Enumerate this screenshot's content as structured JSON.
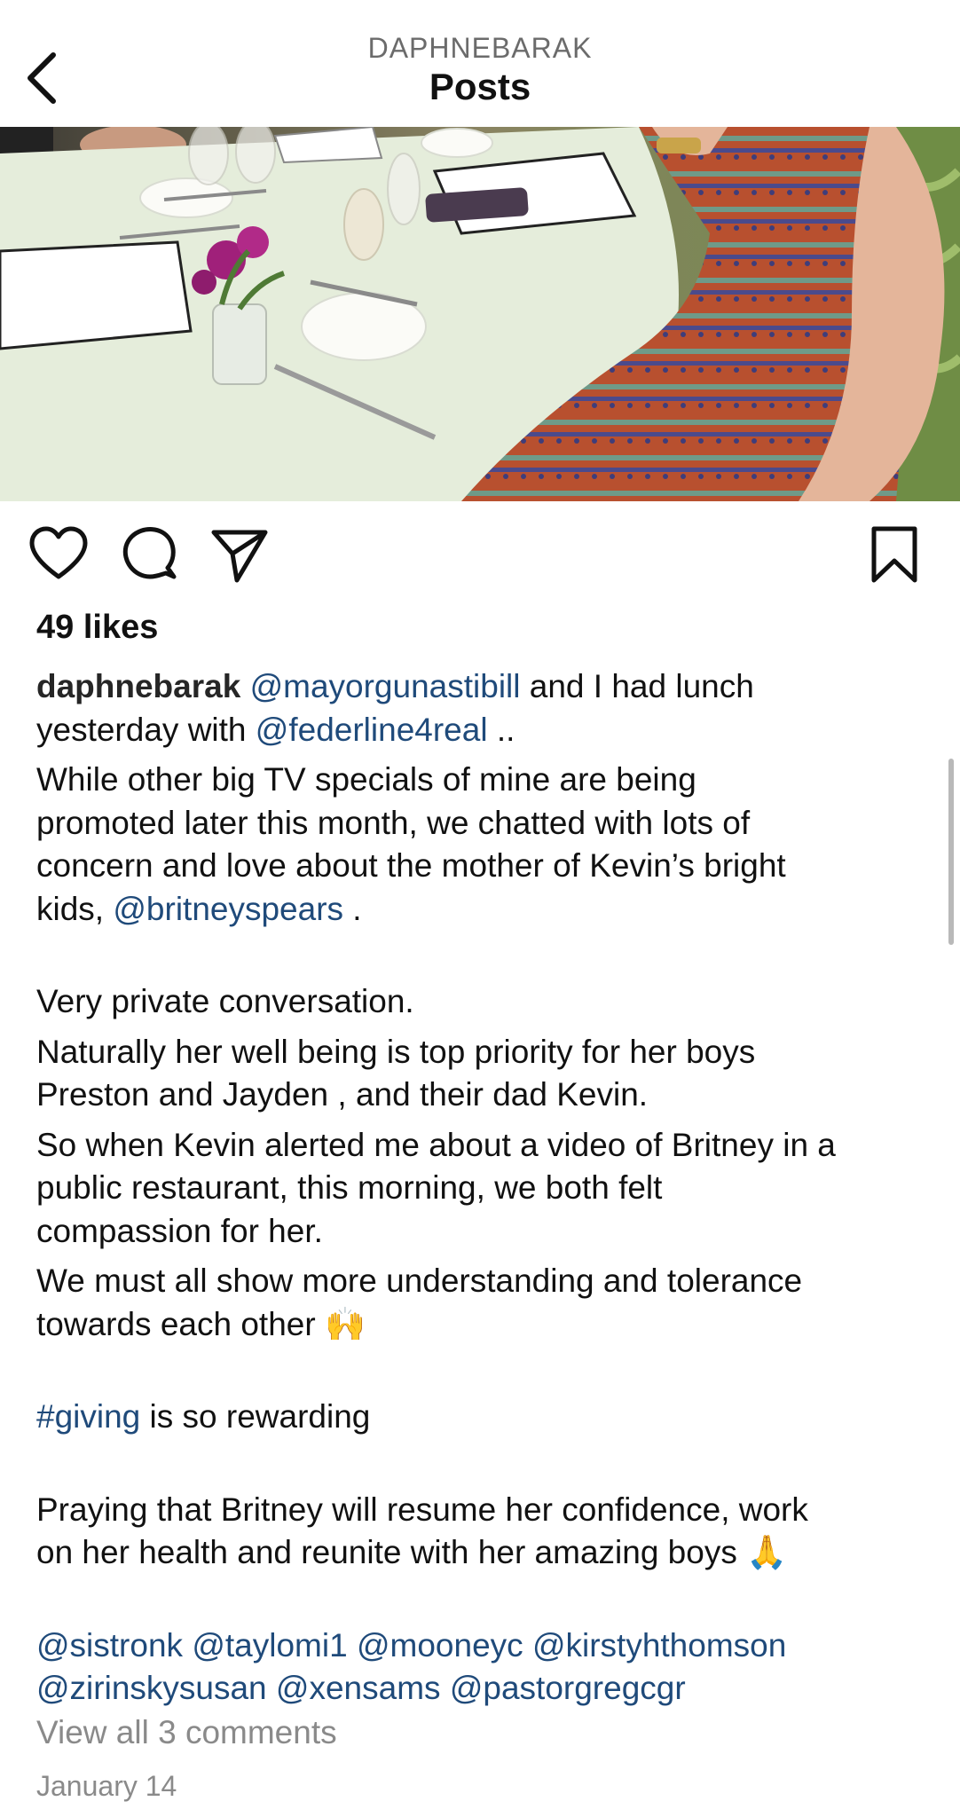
{
  "header": {
    "username": "DAPHNEBARAK",
    "title": "Posts"
  },
  "icons": {
    "back": "chevron-left-icon",
    "like": "heart-icon",
    "comment": "comment-bubble-icon",
    "share": "paper-plane-icon",
    "save": "bookmark-icon"
  },
  "post": {
    "likes": "49 likes",
    "caption": {
      "username": "daphnebarak",
      "mention_mayor": "@mayorgunastibill",
      "l1_text": " and I had lunch",
      "l2_text1": "yesterday with ",
      "mention_federline": "@federline4real",
      "l2_text2": " ..",
      "l3": "While other big TV specials  of mine are being",
      "l4": "promoted later this month, we chatted with lots of",
      "l5": "concern and love about the mother of Kevin’s bright",
      "l6_text1": "kids, ",
      "mention_britney": "@britneyspears",
      "l6_text2": " .",
      "l7": "Very private conversation.",
      "l8": "Naturally her well being is  top priority for her boys",
      "l9": "Preston and Jayden , and their dad Kevin.",
      "l10": "So when Kevin alerted me about a video of Britney in a",
      "l11": "public restaurant, this morning, we both felt",
      "l12": "compassion for her.",
      "l13": "We must all show more understanding and tolerance",
      "l14_text": "towards each other ",
      "emoji_raising_hands": "🙌",
      "hashtag_giving": "#giving",
      "l15_text": " is so rewarding",
      "l16": "Praying that Britney will resume her confidence, work",
      "l17_text": "on her health and reunite with her amazing boys ",
      "emoji_praying": "🙏",
      "tags": [
        "@sistronk",
        "@taylomi1",
        "@mooneyc",
        "@kirstyhthomson",
        "@zirinskysusan",
        "@xensams",
        "@pastorgregcgr"
      ]
    },
    "view_comments": "View all 3 comments",
    "date": "January 14"
  }
}
